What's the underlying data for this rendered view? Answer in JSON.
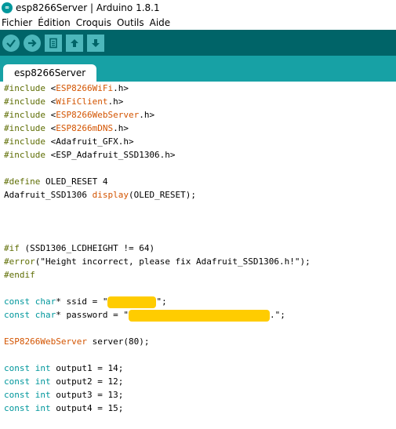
{
  "window": {
    "title": "esp8266Server | Arduino 1.8.1",
    "logo_text": "∞"
  },
  "menu": {
    "items": [
      "Fichier",
      "Édition",
      "Croquis",
      "Outils",
      "Aide"
    ]
  },
  "toolbar": {
    "buttons": [
      {
        "name": "verify-button",
        "icon": "check-icon"
      },
      {
        "name": "upload-button",
        "icon": "arrow-right-icon"
      },
      {
        "name": "new-button",
        "icon": "document-icon"
      },
      {
        "name": "open-button",
        "icon": "arrow-up-icon"
      },
      {
        "name": "save-button",
        "icon": "arrow-down-icon"
      }
    ]
  },
  "tabs": [
    {
      "label": "esp8266Server"
    }
  ],
  "colors": {
    "toolbar_bg": "#006468",
    "tabstrip_bg": "#17A1A5",
    "button_bg": "#4DB7BB",
    "preproc": "#5E6D03",
    "library": "#D35400",
    "type": "#00979C",
    "redaction": "#FFCC00"
  },
  "code": {
    "inc1": {
      "a": "#include",
      "b": " <",
      "c": "ESP8266WiFi",
      "d": ".h>"
    },
    "inc2": {
      "a": "#include",
      "b": " <",
      "c": "WiFiClient",
      "d": ".h>"
    },
    "inc3": {
      "a": "#include",
      "b": " <",
      "c": "ESP8266WebServer",
      "d": ".h>"
    },
    "inc4": {
      "a": "#include",
      "b": " <",
      "c": "ESP8266mDNS",
      "d": ".h>"
    },
    "inc5": {
      "a": "#include",
      "b": " <Adafruit_GFX.h>"
    },
    "inc6": {
      "a": "#include",
      "b": " <ESP_Adafruit_SSD1306.h>"
    },
    "def1": {
      "a": "#define",
      "b": " OLED_RESET 4"
    },
    "disp": {
      "a": "Adafruit_SSD1306 ",
      "b": "display",
      "c": "(OLED_RESET);"
    },
    "if1": {
      "a": "#if",
      "b": " (SSD1306_LCDHEIGHT != 64)"
    },
    "err1": {
      "a": "#error",
      "b": "(\"Height incorrect, please fix Adafruit_SSD1306.h!\");"
    },
    "end1": {
      "a": "#endif"
    },
    "ssid": {
      "a": "const",
      "b": " ",
      "c": "char",
      "d": "* ssid = \"",
      "e": "\";"
    },
    "pass": {
      "a": "const",
      "b": " ",
      "c": "char",
      "d": "* password = \"",
      "e": ".\";"
    },
    "srv": {
      "a": "ESP8266WebServer",
      "b": " server(80);"
    },
    "out1": {
      "a": "const",
      "b": " ",
      "c": "int",
      "d": " output1 = 14;"
    },
    "out2": {
      "a": "const",
      "b": " ",
      "c": "int",
      "d": " output2 = 12;"
    },
    "out3": {
      "a": "const",
      "b": " ",
      "c": "int",
      "d": " output3 = 13;"
    },
    "out4": {
      "a": "const",
      "b": " ",
      "c": "int",
      "d": " output4 = 15;"
    }
  }
}
